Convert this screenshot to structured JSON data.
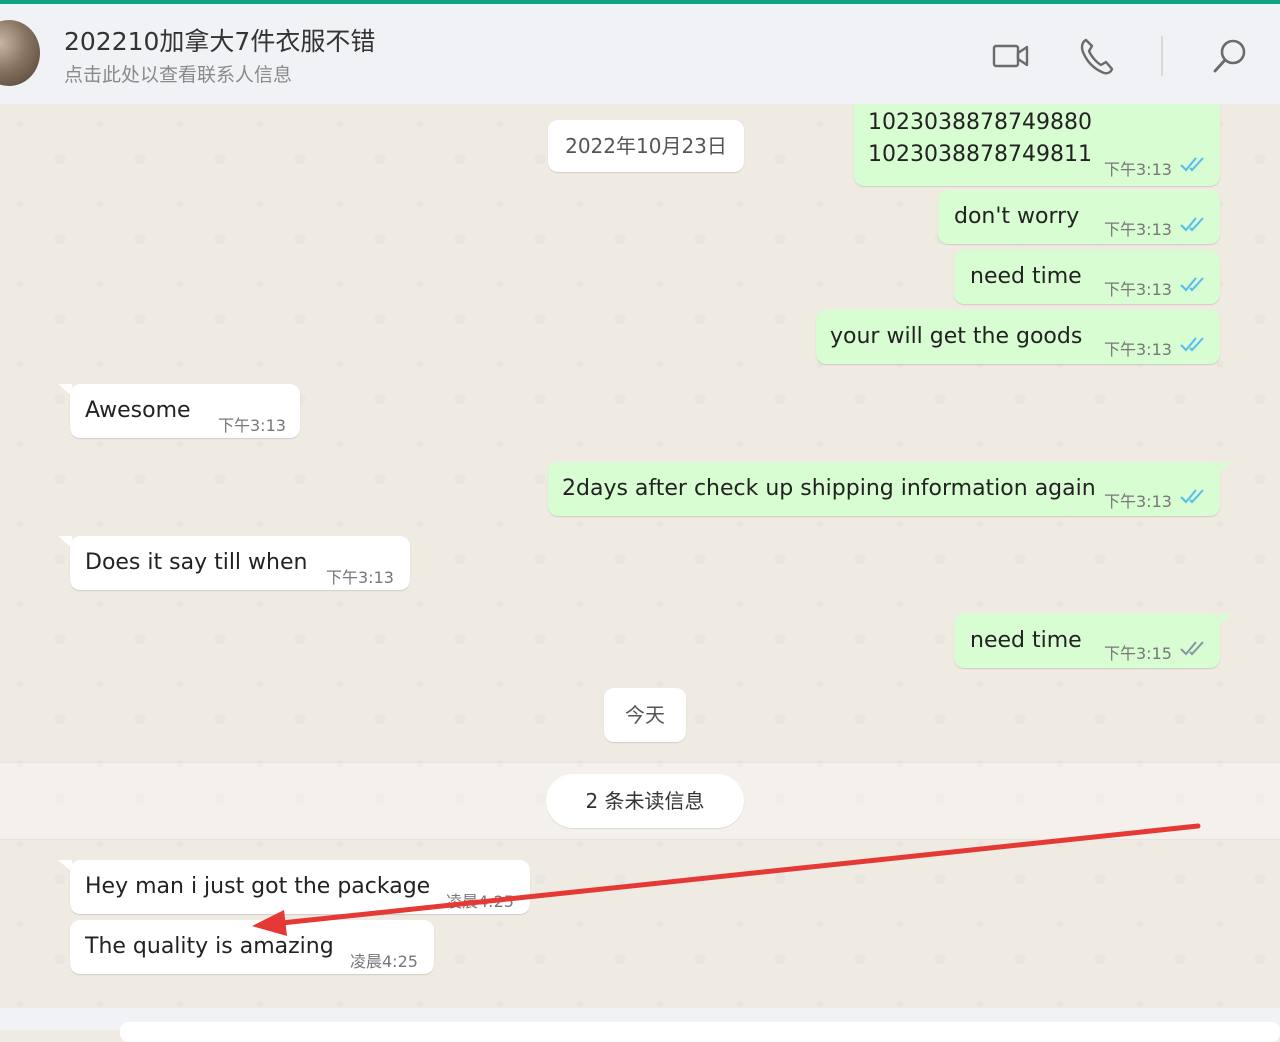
{
  "header": {
    "title": "202210加拿大7件衣服不错",
    "subtitle": "点击此处以查看联系人信息",
    "icons": [
      "video-call-icon",
      "voice-call-icon",
      "search-icon"
    ]
  },
  "dates": {
    "first": "2022年10月23日",
    "today": "今天"
  },
  "unread_label": "2 条未读信息",
  "messages": [
    {
      "dir": "out",
      "text_line1": "1023038878749880",
      "text_line2": "1023038878749811",
      "time": "下午3:13",
      "read": true
    },
    {
      "dir": "out",
      "text": "don't worry",
      "time": "下午3:13",
      "read": true
    },
    {
      "dir": "out",
      "text": "need time",
      "time": "下午3:13",
      "read": true
    },
    {
      "dir": "out",
      "text": "your will get the goods",
      "time": "下午3:13",
      "read": true
    },
    {
      "dir": "in",
      "text": "Awesome",
      "time": "下午3:13"
    },
    {
      "dir": "out",
      "text": "2days after check up shipping information again",
      "time": "下午3:13",
      "read": true
    },
    {
      "dir": "in",
      "text": "Does it say till when",
      "time": "下午3:13"
    },
    {
      "dir": "out",
      "text": "need time",
      "time": "下午3:15",
      "read": false
    },
    {
      "dir": "in",
      "text": "Hey man i just got the package",
      "time": "凌晨4:25"
    },
    {
      "dir": "in",
      "text": "The quality is amazing",
      "time": "凌晨4:25"
    }
  ],
  "colors": {
    "outgoing_bubble": "#d9fdd3",
    "incoming_bubble": "#ffffff",
    "read_tick": "#53bdeb",
    "unread_tick": "#8696a0",
    "annotation_arrow": "#e53935"
  }
}
